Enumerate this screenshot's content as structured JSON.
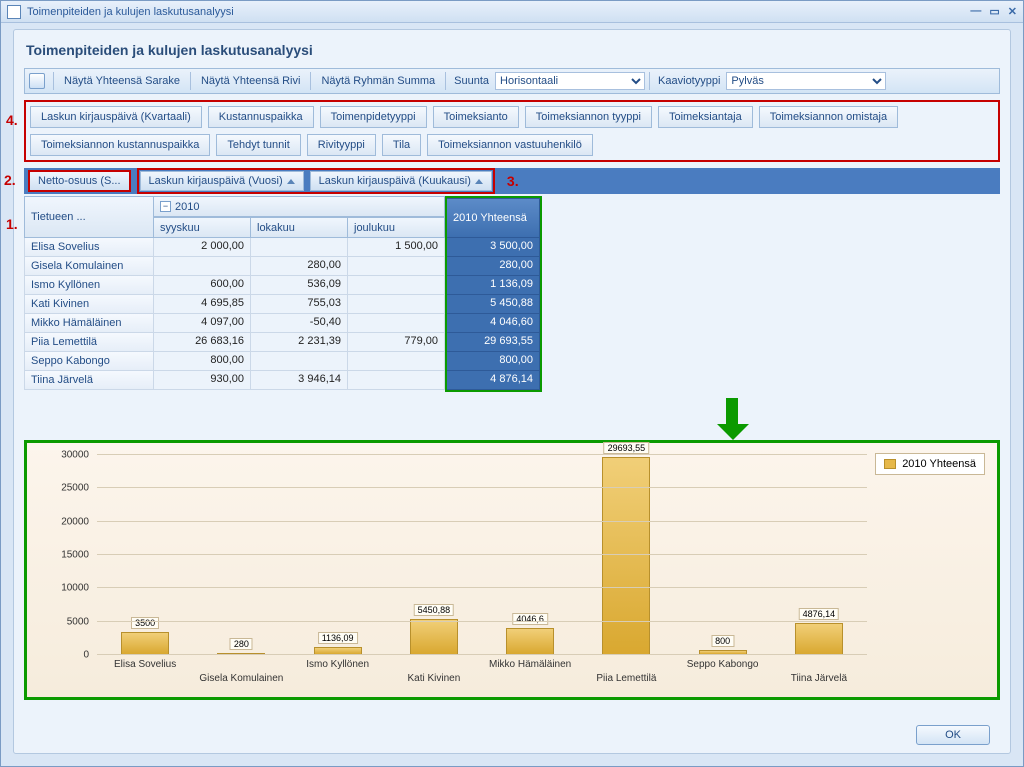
{
  "window": {
    "title": "Toimenpiteiden ja kulujen laskutusanalyysi"
  },
  "page": {
    "title": "Toimenpiteiden ja kulujen laskutusanalyysi"
  },
  "toolbar": {
    "show_total_col": "Näytä Yhteensä Sarake",
    "show_total_row": "Näytä Yhteensä Rivi",
    "show_group_sum": "Näytä Ryhmän Summa",
    "direction_label": "Suunta",
    "direction_value": "Horisontaali",
    "charttype_label": "Kaaviotyyppi",
    "charttype_value": "Pylväs"
  },
  "annotations": {
    "n1": "1.",
    "n2": "2.",
    "n3": "3.",
    "n4": "4."
  },
  "filters": [
    "Laskun kirjauspäivä (Kvartaali)",
    "Kustannuspaikka",
    "Toimenpidetyyppi",
    "Toimeksianto",
    "Toimeksiannon tyyppi",
    "Toimeksiantaja",
    "Toimeksiannon omistaja",
    "Toimeksiannon kustannuspaikka",
    "Tehdyt tunnit",
    "Rivityyppi",
    "Tila",
    "Toimeksiannon vastuuhenkilö"
  ],
  "dims": {
    "measure": "Netto-osuus (S...",
    "colyear": "Laskun kirjauspäivä (Vuosi)",
    "colmonth": "Laskun kirjauspäivä (Kuukausi)",
    "rowdim": "Tietueen ..."
  },
  "columns": {
    "year": "2010",
    "months": [
      "syyskuu",
      "lokakuu",
      "joulukuu"
    ],
    "total": "2010 Yhteensä"
  },
  "rows": [
    {
      "name": "Elisa Sovelius",
      "v": [
        "2 000,00",
        "",
        "1 500,00"
      ],
      "t": "3 500,00"
    },
    {
      "name": "Gisela Komulainen",
      "v": [
        "",
        "280,00",
        ""
      ],
      "t": "280,00"
    },
    {
      "name": "Ismo Kyllönen",
      "v": [
        "600,00",
        "536,09",
        ""
      ],
      "t": "1 136,09"
    },
    {
      "name": "Kati Kivinen",
      "v": [
        "4 695,85",
        "755,03",
        ""
      ],
      "t": "5 450,88"
    },
    {
      "name": "Mikko Hämäläinen",
      "v": [
        "4 097,00",
        "-50,40",
        ""
      ],
      "t": "4 046,60"
    },
    {
      "name": "Piia Lemettilä",
      "v": [
        "26 683,16",
        "2 231,39",
        "779,00"
      ],
      "t": "29 693,55"
    },
    {
      "name": "Seppo Kabongo",
      "v": [
        "800,00",
        "",
        ""
      ],
      "t": "800,00"
    },
    {
      "name": "Tiina Järvelä",
      "v": [
        "930,00",
        "3 946,14",
        ""
      ],
      "t": "4 876,14"
    }
  ],
  "chart_data": {
    "type": "bar",
    "title": "",
    "xlabel": "",
    "ylabel": "",
    "ylim": [
      0,
      30000
    ],
    "yticks": [
      0,
      5000,
      10000,
      15000,
      20000,
      25000,
      30000
    ],
    "series_name": "2010 Yhteensä",
    "categories": [
      "Elisa Sovelius",
      "Gisela Komulainen",
      "Ismo Kyllönen",
      "Kati Kivinen",
      "Mikko Hämäläinen",
      "Piia Lemettilä",
      "Seppo Kabongo",
      "Tiina Järvelä"
    ],
    "values": [
      3500,
      280,
      1136.09,
      5450.88,
      4046.6,
      29693.55,
      800,
      4876.14
    ],
    "value_labels": [
      "3500",
      "280",
      "1136,09",
      "5450,88",
      "4046,6",
      "29693,55",
      "800",
      "4876,14"
    ]
  },
  "buttons": {
    "ok": "OK"
  }
}
